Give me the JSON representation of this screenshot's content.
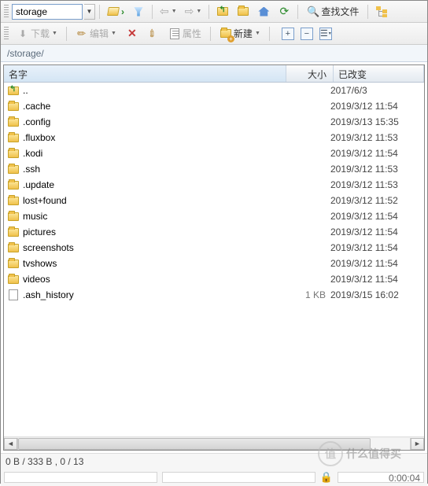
{
  "toolbar1": {
    "address_value": "storage",
    "find_files_label": "查找文件"
  },
  "toolbar2": {
    "download_label": "下载",
    "edit_label": "编辑",
    "properties_label": "属性",
    "new_label": "新建"
  },
  "path": "/storage/",
  "columns": {
    "name": "名字",
    "size": "大小",
    "changed": "已改变"
  },
  "items": [
    {
      "type": "up",
      "name": "..",
      "size": "",
      "date": "2017/6/3"
    },
    {
      "type": "folder",
      "name": ".cache",
      "size": "",
      "date": "2019/3/12 11:54"
    },
    {
      "type": "folder",
      "name": ".config",
      "size": "",
      "date": "2019/3/13 15:35"
    },
    {
      "type": "folder",
      "name": ".fluxbox",
      "size": "",
      "date": "2019/3/12 11:53"
    },
    {
      "type": "folder",
      "name": ".kodi",
      "size": "",
      "date": "2019/3/12 11:54"
    },
    {
      "type": "folder",
      "name": ".ssh",
      "size": "",
      "date": "2019/3/12 11:53"
    },
    {
      "type": "folder",
      "name": ".update",
      "size": "",
      "date": "2019/3/12 11:53"
    },
    {
      "type": "folder",
      "name": "lost+found",
      "size": "",
      "date": "2019/3/12 11:52"
    },
    {
      "type": "folder",
      "name": "music",
      "size": "",
      "date": "2019/3/12 11:54"
    },
    {
      "type": "folder",
      "name": "pictures",
      "size": "",
      "date": "2019/3/12 11:54"
    },
    {
      "type": "folder",
      "name": "screenshots",
      "size": "",
      "date": "2019/3/12 11:54"
    },
    {
      "type": "folder",
      "name": "tvshows",
      "size": "",
      "date": "2019/3/12 11:54"
    },
    {
      "type": "folder",
      "name": "videos",
      "size": "",
      "date": "2019/3/12 11:54"
    },
    {
      "type": "file",
      "name": ".ash_history",
      "size": "1 KB",
      "date": "2019/3/15 16:02"
    }
  ],
  "status": {
    "selection": "0 B / 333 B , 0 / 13",
    "elapsed": "0:00:04"
  },
  "watermark": {
    "char": "值",
    "text": "什么值得买"
  }
}
